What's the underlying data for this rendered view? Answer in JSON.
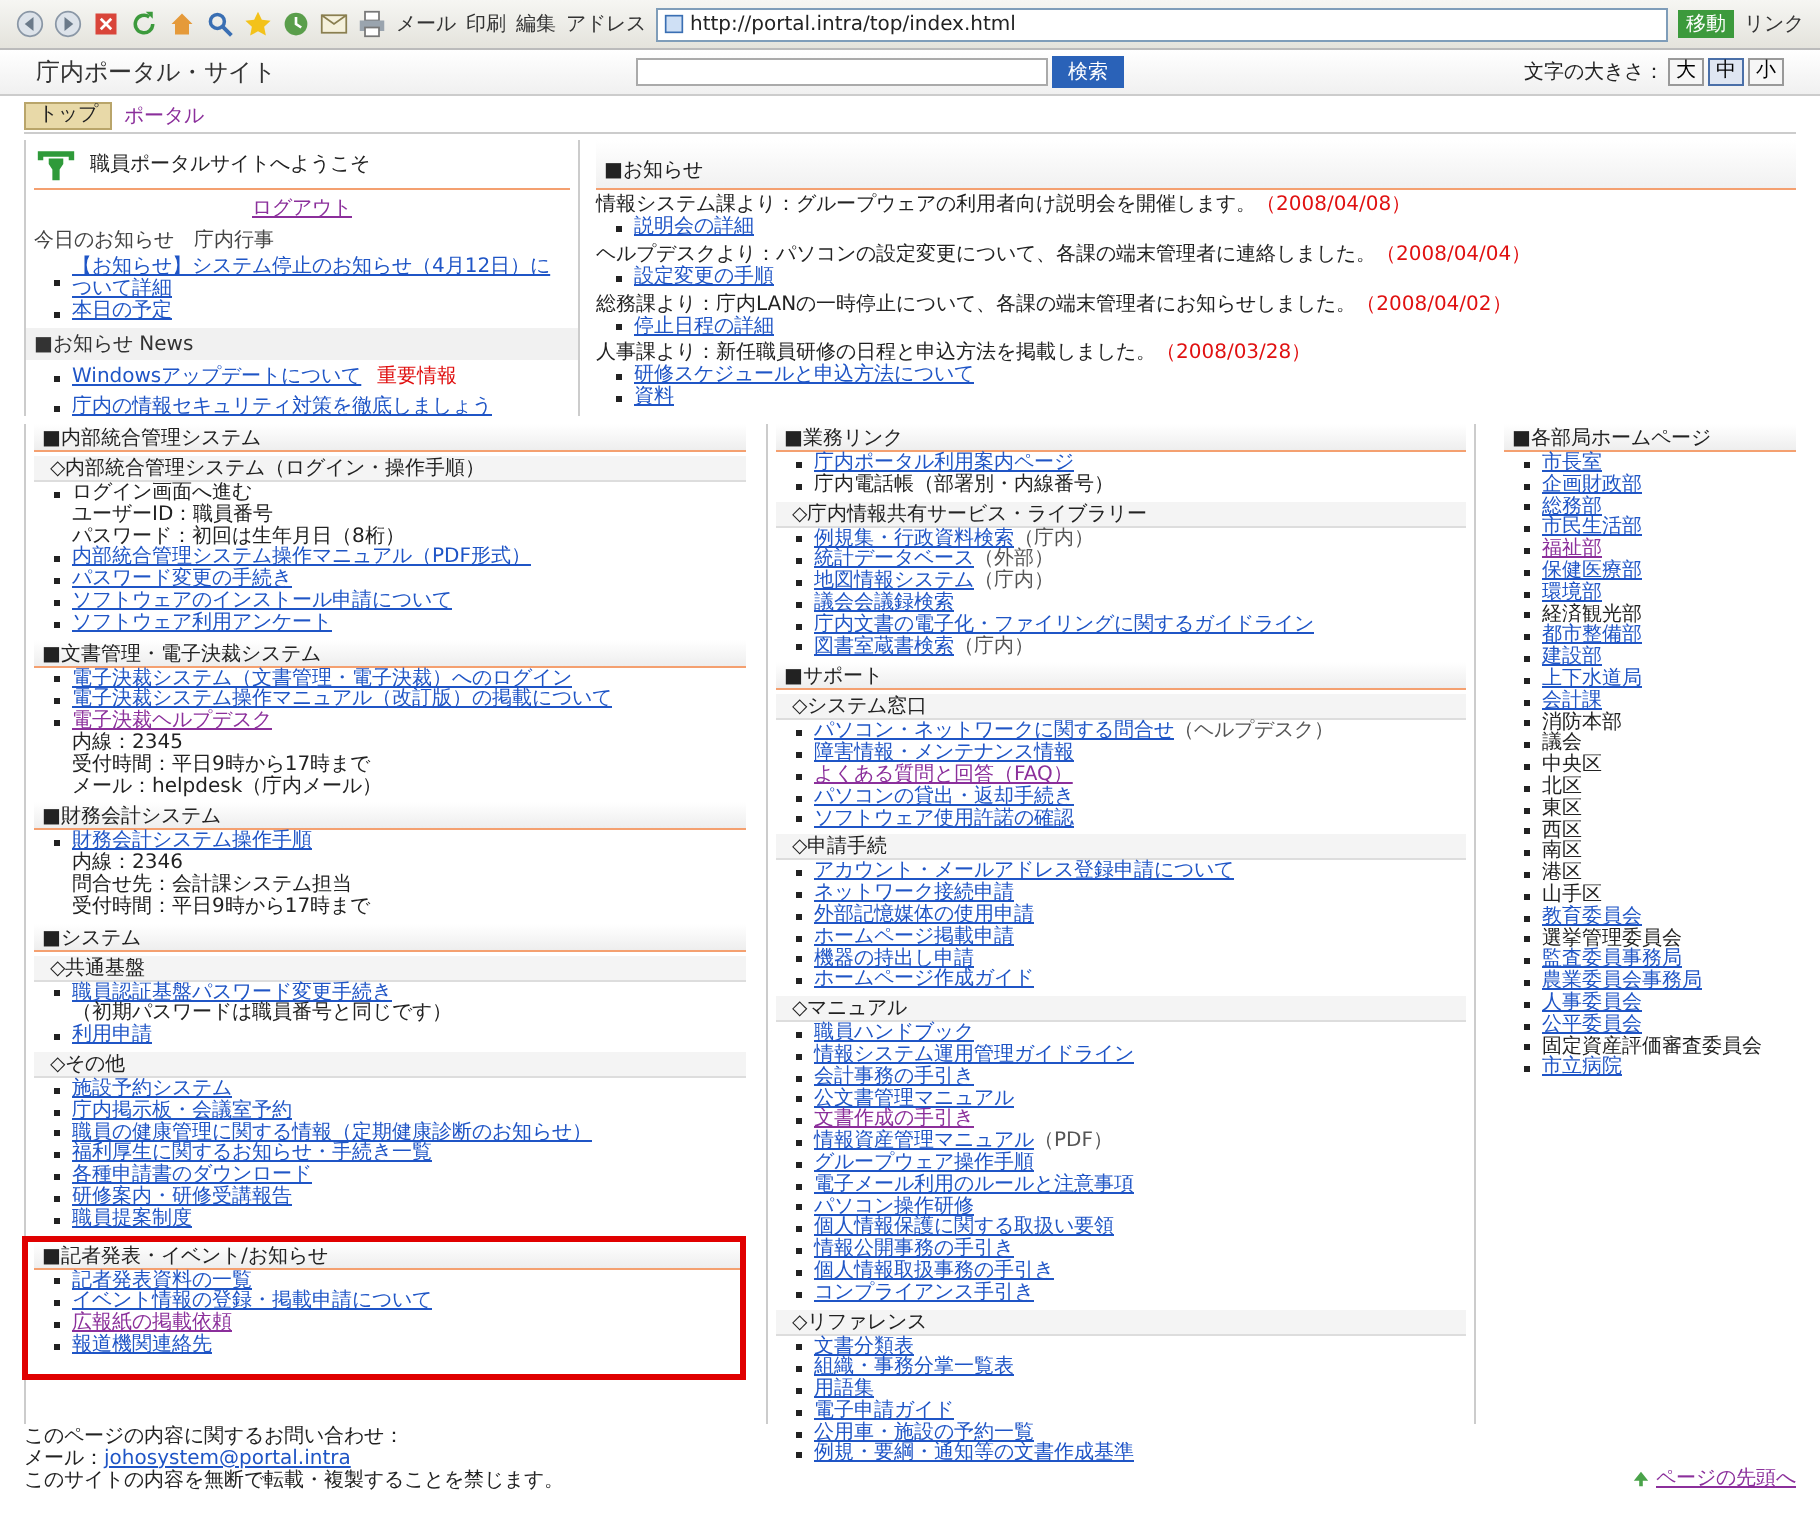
{
  "toolbar": {
    "labels": [
      "メール",
      "印刷",
      "編集"
    ],
    "address_label": "アドレス",
    "address": "http://portal.intra/top/index.html",
    "go": "移動",
    "links": "リンク"
  },
  "header": {
    "title": "庁内ポータル・サイト",
    "search_button": "検索",
    "size_label": "文字の大きさ：",
    "sizes": [
      {
        "label": "大",
        "selected": false
      },
      {
        "label": "中",
        "selected": true
      },
      {
        "label": "小",
        "selected": false
      }
    ]
  },
  "breadcrumb": {
    "home": "トップ",
    "current": "ポータル"
  },
  "welcome": {
    "title": "職員ポータルサイトへようこそ",
    "logout": "ログアウト",
    "today": "今日のお知らせ　庁内行事",
    "today_items": [
      "【お知らせ】システム停止のお知らせ（4月12日）について詳細",
      "本日の予定"
    ],
    "news_title": "■お知らせ News",
    "news": [
      {
        "text": "Windowsアップデートについて",
        "badge": "重要情報"
      },
      {
        "text": "庁内の情報セキュリティ対策を徹底しましょう"
      }
    ]
  },
  "notices": {
    "title": "■お知らせ",
    "entries": [
      {
        "text": "情報システム課より：グループウェアの利用者向け説明会を開催します。",
        "date": "（2008/04/08）",
        "links": [
          "説明会の詳細"
        ]
      },
      {
        "text": "ヘルプデスクより：パソコンの設定変更について、各課の端末管理者に連絡しました。",
        "date": "（2008/04/04）",
        "links": [
          "設定変更の手順"
        ]
      },
      {
        "text": "総務課より：庁内LANの一時停止について、各課の端末管理者にお知らせしました。",
        "date": "（2008/04/02）",
        "links": [
          "停止日程の詳細"
        ]
      },
      {
        "text": "人事課より：新任職員研修の日程と申込方法を掲載しました。",
        "date": "（2008/03/28）",
        "links": [
          "研修スケジュールと申込方法について",
          "資料"
        ]
      }
    ]
  },
  "columns": [
    {
      "sections": [
        {
          "kind": "main",
          "title": "■内部統合管理システム"
        },
        {
          "kind": "sub",
          "title": "◇内部統合管理システム（ログイン・操作手順）",
          "items": [
            {
              "kind": "text",
              "text": "ログイン画面へ進む",
              "details": [
                "ユーザーID：職員番号",
                "パスワード：初回は生年月日（8桁）"
              ]
            },
            {
              "kind": "link",
              "text": "内部統合管理システム操作マニュアル（PDF形式）"
            },
            {
              "kind": "link",
              "text": "パスワード変更の手続き"
            },
            {
              "kind": "link",
              "text": "ソフトウェアのインストール申請について"
            },
            {
              "kind": "link",
              "text": "ソフトウェア利用アンケート"
            }
          ]
        },
        {
          "kind": "main",
          "title": "■文書管理・電子決裁システム",
          "items": [
            {
              "kind": "link",
              "text": "電子決裁システム（文書管理・電子決裁）へのログイン"
            },
            {
              "kind": "link",
              "text": "電子決裁システム操作マニュアル（改訂版）の掲載について"
            },
            {
              "kind": "visited",
              "text": "電子決裁ヘルプデスク",
              "details": [
                "内線：2345",
                "受付時間：平日9時から17時まで",
                "メール：helpdesk（庁内メール）"
              ]
            }
          ]
        },
        {
          "kind": "main",
          "title": "■財務会計システム",
          "items": [
            {
              "kind": "link",
              "text": "財務会計システム操作手順",
              "details": [
                "内線：2346",
                "問合せ先：会計課システム担当",
                "受付時間：平日9時から17時まで"
              ]
            }
          ]
        },
        {
          "kind": "main",
          "title": "■システム"
        },
        {
          "kind": "sub",
          "title": "◇共通基盤",
          "items": [
            {
              "kind": "link",
              "text": "職員認証基盤パスワード変更手続き",
              "details": [
                "（初期パスワードは職員番号と同じです）"
              ]
            },
            {
              "kind": "link",
              "text": "利用申請"
            }
          ]
        },
        {
          "kind": "sub",
          "title": "◇その他",
          "items": [
            {
              "kind": "link",
              "text": "施設予約システム"
            },
            {
              "kind": "link",
              "text": "庁内掲示板・会議室予約"
            },
            {
              "kind": "link",
              "text": "職員の健康管理に関する情報（定期健康診断のお知らせ）"
            },
            {
              "kind": "link",
              "text": "福利厚生に関するお知らせ・手続き一覧"
            },
            {
              "kind": "link",
              "text": "各種申請書のダウンロード"
            },
            {
              "kind": "link",
              "text": "研修案内・研修受講報告"
            },
            {
              "kind": "link",
              "text": "職員提案制度"
            }
          ]
        },
        {
          "kind": "highlight",
          "title": "■記者発表・イベント/お知らせ",
          "items": [
            {
              "kind": "link",
              "text": "記者発表資料の一覧"
            },
            {
              "kind": "link",
              "text": "イベント情報の登録・掲載申請について"
            },
            {
              "kind": "visited",
              "text": "広報紙の掲載依頼"
            },
            {
              "kind": "link",
              "text": "報道機関連絡先"
            }
          ]
        }
      ]
    },
    {
      "sections": [
        {
          "kind": "main",
          "title": "■業務リンク",
          "items": [
            {
              "kind": "link",
              "text": "庁内ポータル利用案内ページ"
            },
            {
              "kind": "text",
              "text": "庁内電話帳（部署別・内線番号）"
            }
          ]
        },
        {
          "kind": "sub",
          "title": "◇庁内情報共有サービス・ライブラリー",
          "items": [
            {
              "kind": "link",
              "text": "例規集・行政資料検索",
              "note": "（庁内）"
            },
            {
              "kind": "link",
              "text": "統計データベース",
              "note": "（外部）"
            },
            {
              "kind": "link",
              "text": "地図情報システム",
              "note": "（庁内）"
            },
            {
              "kind": "link",
              "text": "議会会議録検索"
            },
            {
              "kind": "link",
              "text": "庁内文書の電子化・ファイリングに関するガイドライン"
            },
            {
              "kind": "link",
              "text": "図書室蔵書検索",
              "note": "（庁内）"
            }
          ]
        },
        {
          "kind": "main",
          "title": "■サポート"
        },
        {
          "kind": "sub",
          "title": "◇システム窓口",
          "items": [
            {
              "kind": "link",
              "text": "パソコン・ネットワークに関する問合せ",
              "note": "（ヘルプデスク）"
            },
            {
              "kind": "link",
              "text": "障害情報・メンテナンス情報"
            },
            {
              "kind": "visited",
              "text": "よくある質問と回答（FAQ）"
            },
            {
              "kind": "link",
              "text": "パソコンの貸出・返却手続き"
            },
            {
              "kind": "link",
              "text": "ソフトウェア使用許諾の確認"
            }
          ]
        },
        {
          "kind": "sub",
          "title": "◇申請手続",
          "items": [
            {
              "kind": "link",
              "text": "アカウント・メールアドレス登録申請について"
            },
            {
              "kind": "link",
              "text": "ネットワーク接続申請"
            },
            {
              "kind": "link",
              "text": "外部記憶媒体の使用申請"
            },
            {
              "kind": "link",
              "text": "ホームページ掲載申請"
            },
            {
              "kind": "link",
              "text": "機器の持出し申請"
            },
            {
              "kind": "link",
              "text": "ホームページ作成ガイド"
            }
          ]
        },
        {
          "kind": "sub",
          "title": "◇マニュアル",
          "items": [
            {
              "kind": "link",
              "text": "職員ハンドブック"
            },
            {
              "kind": "link",
              "text": "情報システム運用管理ガイドライン"
            },
            {
              "kind": "link",
              "text": "会計事務の手引き"
            },
            {
              "kind": "link",
              "text": "公文書管理マニュアル"
            },
            {
              "kind": "visited",
              "text": "文書作成の手引き"
            },
            {
              "kind": "link",
              "text": "情報資産管理マニュアル",
              "note": "（PDF）"
            },
            {
              "kind": "link",
              "text": "グループウェア操作手順"
            },
            {
              "kind": "link",
              "text": "電子メール利用のルールと注意事項"
            },
            {
              "kind": "link",
              "text": "パソコン操作研修"
            },
            {
              "kind": "link",
              "text": "個人情報保護に関する取扱い要領"
            },
            {
              "kind": "link",
              "text": "情報公開事務の手引き"
            },
            {
              "kind": "link",
              "text": "個人情報取扱事務の手引き"
            },
            {
              "kind": "link",
              "text": "コンプライアンス手引き"
            }
          ]
        },
        {
          "kind": "sub",
          "title": "◇リファレンス",
          "items": [
            {
              "kind": "link",
              "text": "文書分類表"
            },
            {
              "kind": "link",
              "text": "組織・事務分掌一覧表"
            },
            {
              "kind": "link",
              "text": "用語集"
            },
            {
              "kind": "link",
              "text": "電子申請ガイド"
            },
            {
              "kind": "link",
              "text": "公用車・施設の予約一覧"
            },
            {
              "kind": "link",
              "text": "例規・要綱・通知等の文書作成基準"
            }
          ]
        }
      ]
    },
    {
      "sections": [
        {
          "kind": "main",
          "title": "■各部局ホームページ",
          "items": [
            {
              "kind": "link",
              "text": "市長室"
            },
            {
              "kind": "link",
              "text": "企画財政部"
            },
            {
              "kind": "link",
              "text": "総務部"
            },
            {
              "kind": "link",
              "text": "市民生活部"
            },
            {
              "kind": "visited",
              "text": "福祉部"
            },
            {
              "kind": "link",
              "text": "保健医療部"
            },
            {
              "kind": "link",
              "text": "環境部"
            },
            {
              "kind": "text",
              "text": "経済観光部"
            },
            {
              "kind": "link",
              "text": "都市整備部"
            },
            {
              "kind": "link",
              "text": "建設部"
            },
            {
              "kind": "link",
              "text": "上下水道局"
            },
            {
              "kind": "link",
              "text": "会計課"
            },
            {
              "kind": "text",
              "text": "消防本部"
            },
            {
              "kind": "text",
              "text": "議会"
            },
            {
              "kind": "text",
              "text": "中央区"
            },
            {
              "kind": "text",
              "text": "北区"
            },
            {
              "kind": "text",
              "text": "東区"
            },
            {
              "kind": "text",
              "text": "西区"
            },
            {
              "kind": "text",
              "text": "南区"
            },
            {
              "kind": "text",
              "text": "港区"
            },
            {
              "kind": "text",
              "text": "山手区"
            },
            {
              "kind": "link",
              "text": "教育委員会"
            },
            {
              "kind": "text",
              "text": "選挙管理委員会"
            },
            {
              "kind": "link",
              "text": "監査委員事務局"
            },
            {
              "kind": "link",
              "text": "農業委員会事務局"
            },
            {
              "kind": "link",
              "text": "人事委員会"
            },
            {
              "kind": "link",
              "text": "公平委員会"
            },
            {
              "kind": "text",
              "text": "固定資産評価審査委員会"
            },
            {
              "kind": "link",
              "text": "市立病院"
            }
          ]
        }
      ]
    }
  ],
  "footer": {
    "lines": [
      {
        "text": "このページの内容に関するお問い合わせ："
      },
      {
        "text": "メール：",
        "link": "johosystem@portal.intra"
      },
      {
        "text": "このサイトの内容を無断で転載・複製することを禁じます。"
      }
    ],
    "top_link": "ページの先頭へ"
  }
}
